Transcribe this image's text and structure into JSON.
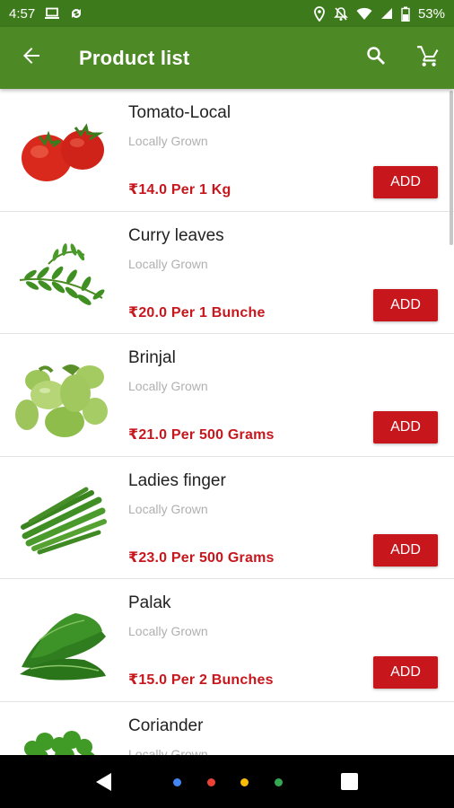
{
  "status_bar": {
    "time": "4:57",
    "battery": "53%",
    "icons": [
      "laptop-icon",
      "sync-icon",
      "location-icon",
      "notifications-off-icon",
      "wifi-icon",
      "signal-icon",
      "battery-icon"
    ]
  },
  "app_bar": {
    "title": "Product list",
    "icons": [
      "back-arrow-icon",
      "search-icon",
      "cart-icon"
    ]
  },
  "products": [
    {
      "name": "Tomato-Local",
      "origin": "Locally Grown",
      "price": "₹14.0  Per  1 Kg",
      "add_label": "ADD"
    },
    {
      "name": "Curry leaves",
      "origin": "Locally Grown",
      "price": "₹20.0  Per  1 Bunche",
      "add_label": "ADD"
    },
    {
      "name": "Brinjal",
      "origin": "Locally Grown",
      "price": "₹21.0  Per  500 Grams",
      "add_label": "ADD"
    },
    {
      "name": "Ladies finger",
      "origin": "Locally Grown",
      "price": "₹23.0  Per  500 Grams",
      "add_label": "ADD"
    },
    {
      "name": "Palak",
      "origin": "Locally Grown",
      "price": "₹15.0  Per  2 Bunches",
      "add_label": "ADD"
    },
    {
      "name": "Coriander",
      "origin": "Locally Grown",
      "price": "",
      "add_label": ""
    }
  ],
  "colors": {
    "status_bar": "#3c7a1b",
    "app_bar": "#4d8a26",
    "accent_red": "#c8161d",
    "nav_dots": [
      "#4285f4",
      "#ea4335",
      "#fbbc05",
      "#34a853"
    ]
  }
}
